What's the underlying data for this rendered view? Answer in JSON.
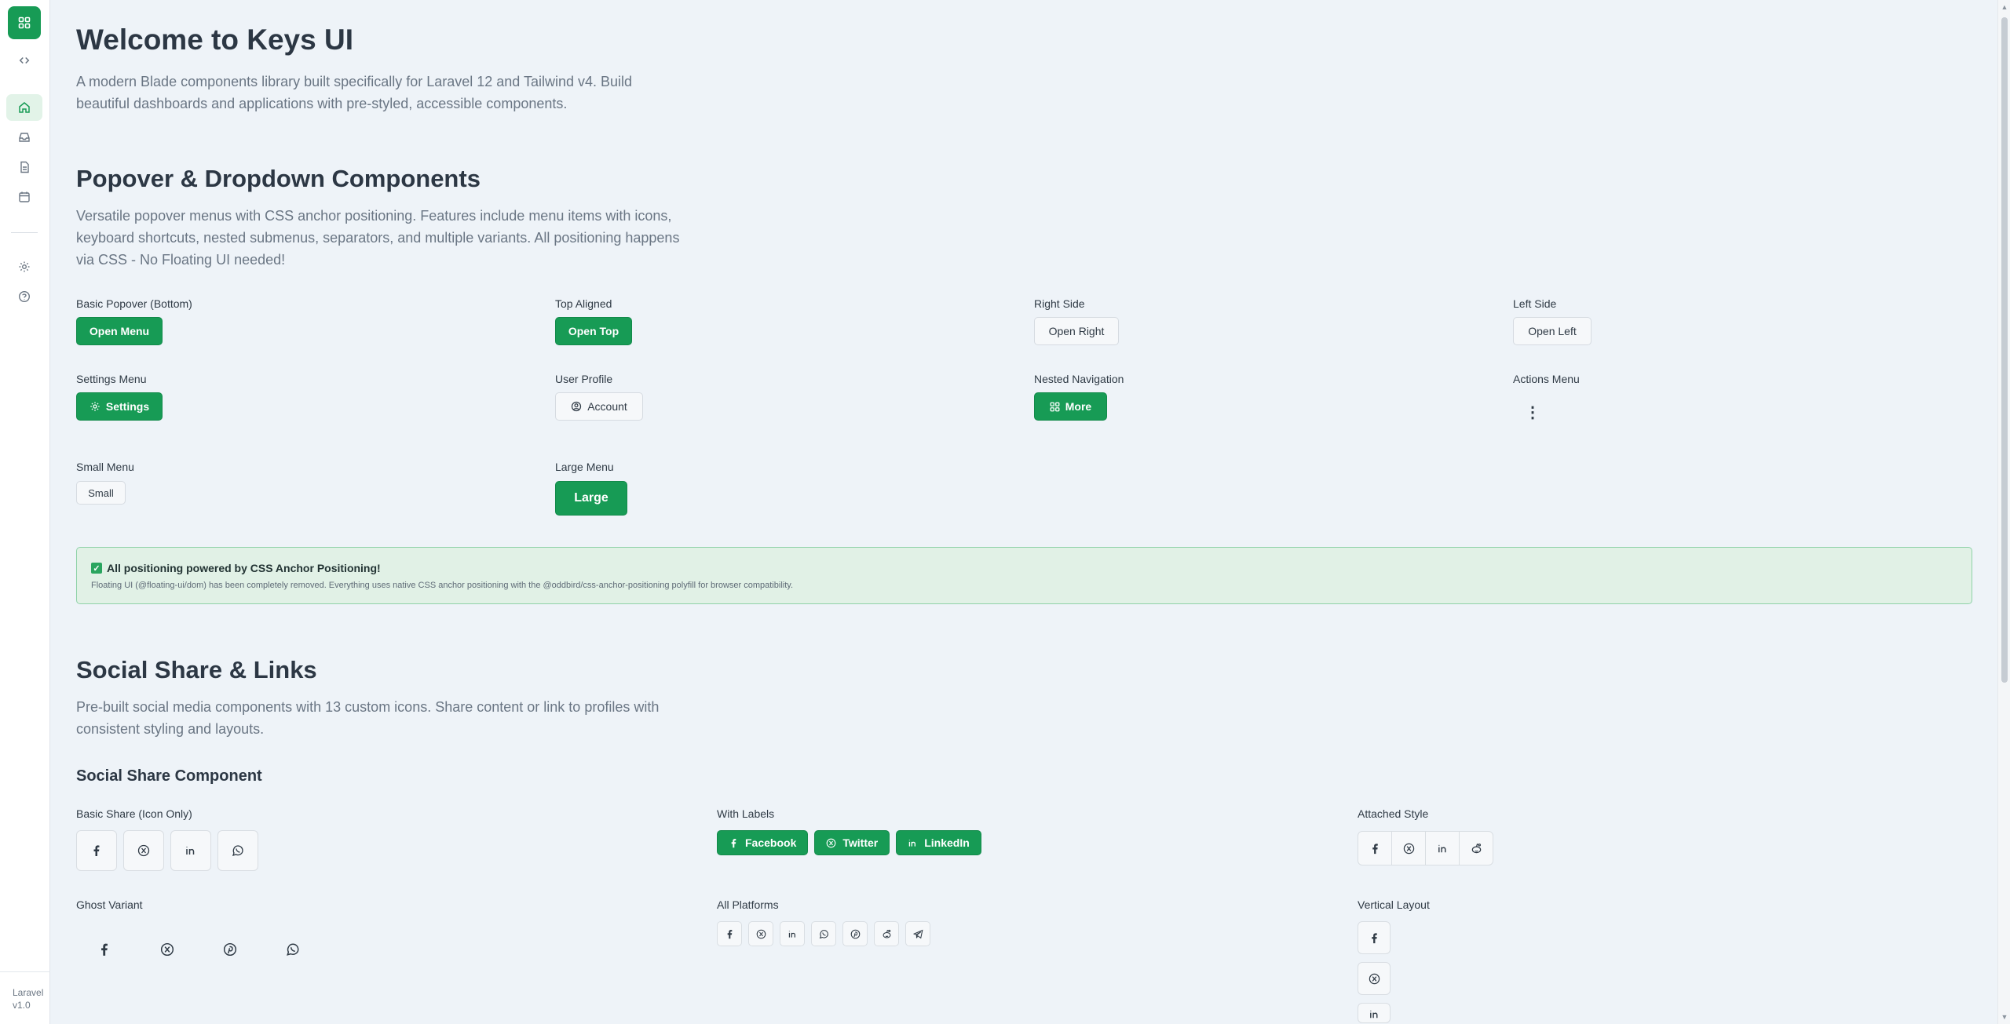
{
  "sidebar": {
    "logo": "grid-logo",
    "items": [
      {
        "icon": "code-icon",
        "label": "Toggle"
      },
      {
        "icon": "home-icon",
        "label": "Home"
      },
      {
        "icon": "inbox-icon",
        "label": "Inbox"
      },
      {
        "icon": "document-icon",
        "label": "Documents"
      },
      {
        "icon": "calendar-icon",
        "label": "Calendar"
      },
      {
        "icon": "gear-icon",
        "label": "Settings"
      },
      {
        "icon": "help-icon",
        "label": "Help"
      }
    ],
    "footer": {
      "name": "Laravel",
      "version": "v1.0"
    }
  },
  "hero": {
    "title": "Welcome to Keys UI",
    "description": "A modern Blade components library built specifically for Laravel 12 and Tailwind v4. Build beautiful dashboards and applications with pre-styled, accessible components."
  },
  "popover": {
    "title": "Popover & Dropdown Components",
    "description": "Versatile popover menus with CSS anchor positioning. Features include menu items with icons, keyboard shortcuts, nested submenus, separators, and multiple variants. All positioning happens via CSS - No Floating UI needed!",
    "basic": {
      "label": "Basic Popover (Bottom)",
      "button": "Open Menu"
    },
    "top": {
      "label": "Top Aligned",
      "button": "Open Top"
    },
    "right": {
      "label": "Right Side",
      "button": "Open Right"
    },
    "left": {
      "label": "Left Side",
      "button": "Open Left"
    },
    "settings": {
      "label": "Settings Menu",
      "button": "Settings"
    },
    "profile": {
      "label": "User Profile",
      "button": "Account"
    },
    "nested": {
      "label": "Nested Navigation",
      "button": "More"
    },
    "actions": {
      "label": "Actions Menu",
      "button": "⋮"
    },
    "small": {
      "label": "Small Menu",
      "button": "Small"
    },
    "large": {
      "label": "Large Menu",
      "button": "Large"
    },
    "callout": {
      "title": "All positioning powered by CSS Anchor Positioning!",
      "body": "Floating UI (@floating-ui/dom) has been completely removed. Everything uses native CSS anchor positioning with the @oddbird/css-anchor-positioning polyfill for browser compatibility."
    }
  },
  "social": {
    "title": "Social Share & Links",
    "description": "Pre-built social media components with 13 custom icons. Share content or link to profiles with consistent styling and layouts.",
    "component_title": "Social Share Component",
    "basic_label": "Basic Share (Icon Only)",
    "labels_label": "With Labels",
    "attached_label": "Attached Style",
    "ghost_label": "Ghost Variant",
    "all_label": "All Platforms",
    "vertical_label": "Vertical Layout",
    "with_labels": [
      "Facebook",
      "Twitter",
      "LinkedIn"
    ]
  },
  "colors": {
    "accent": "#179b55",
    "background": "#eef3f8"
  }
}
